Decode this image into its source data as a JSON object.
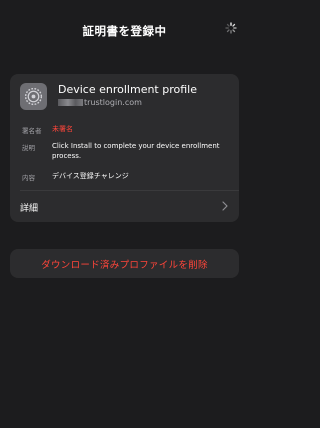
{
  "header": {
    "title": "証明書を登録中",
    "spinner_icon": "activity-spinner-icon"
  },
  "profile": {
    "icon": "gear-icon",
    "name": "Device enrollment profile",
    "domain_suffix": "trustlogin.com"
  },
  "details_rows": [
    {
      "label": "署名者",
      "value": "未署名"
    },
    {
      "label": "説明",
      "value": "Click Install to complete your device enrollment process."
    },
    {
      "label": "内容",
      "value": "デバイス登録チャレンジ"
    }
  ],
  "more": {
    "label": "詳細",
    "icon": "chevron-right-icon"
  },
  "actions": {
    "delete_label": "ダウンロード済みプロファイルを削除"
  },
  "colors": {
    "background": "#1c1c1e",
    "card": "#2c2c2e",
    "destructive": "#ff453a",
    "secondary_text": "#a0a0a5"
  }
}
